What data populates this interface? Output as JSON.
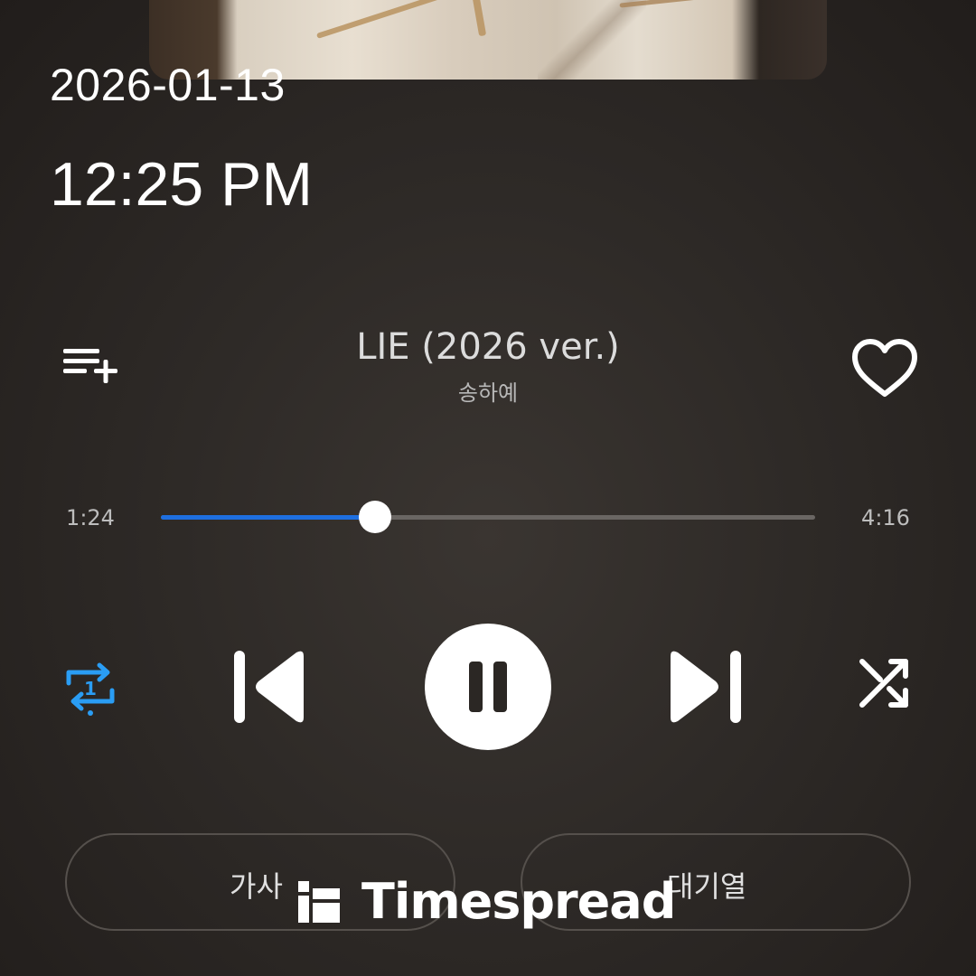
{
  "lockscreen": {
    "date": "2026-01-13",
    "time": "12:25 PM"
  },
  "player": {
    "track_title": "LIE (2026 ver.)",
    "artist": "송하예",
    "elapsed": "1:24",
    "duration": "4:16",
    "progress_fraction": 0.328,
    "repeat_mode": "repeat-one",
    "repeat_badge": "1",
    "state": "playing"
  },
  "buttons": {
    "lyrics_label": "가사",
    "queue_label": "대기열"
  },
  "icons": {
    "queue_add": "playlist-add-icon",
    "like": "heart-outline-icon",
    "repeat": "repeat-one-icon",
    "previous": "skip-previous-icon",
    "pause": "pause-icon",
    "next": "skip-next-icon",
    "shuffle": "shuffle-icon"
  },
  "colors": {
    "accent": "#1e6fe0",
    "repeat_active": "#2a9df4",
    "background": "#2b2724",
    "text": "#ffffff"
  },
  "watermark": {
    "text": "Timespread"
  }
}
